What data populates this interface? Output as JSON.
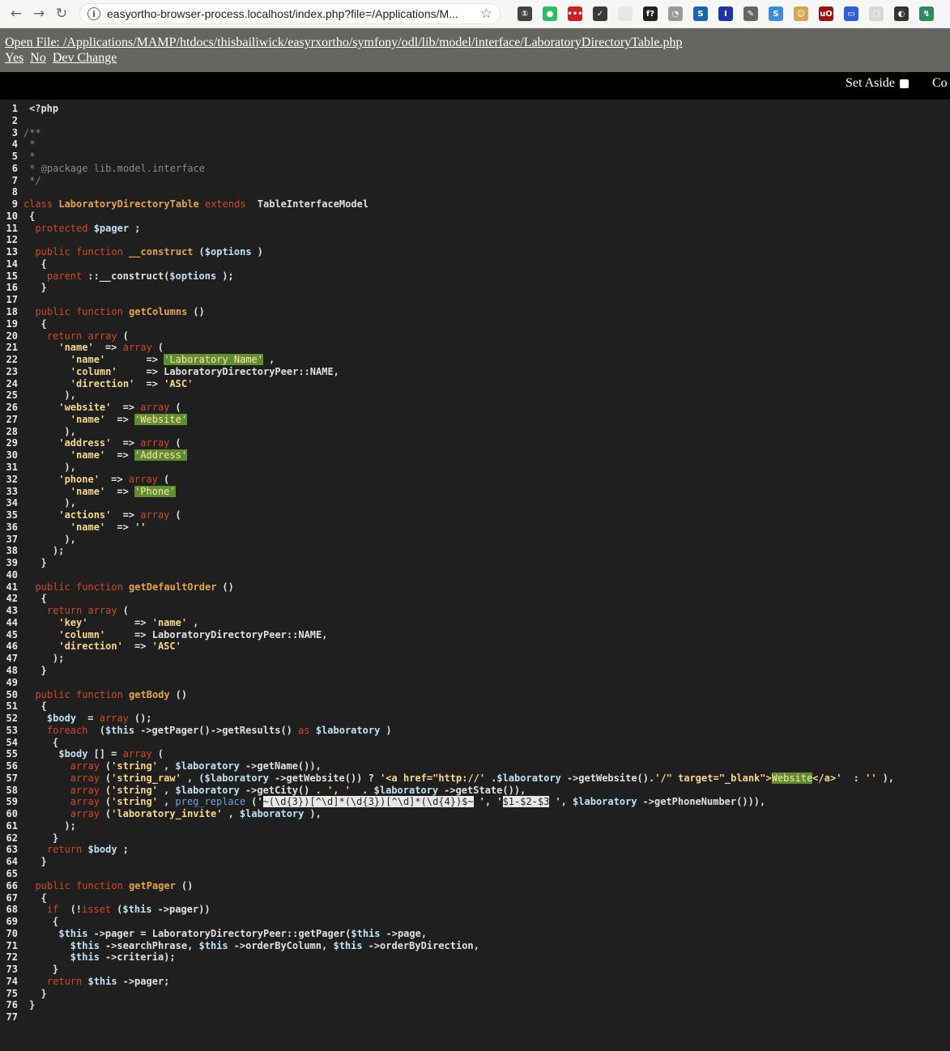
{
  "browser": {
    "url": "easyortho-browser-process.localhost/index.php?file=/Applications/M...",
    "back_glyph": "←",
    "forward_glyph": "→",
    "reload_glyph": "↻",
    "info_glyph": "i",
    "star_glyph": "☆",
    "extensions": [
      {
        "name": "1password-icon",
        "glyph": "①",
        "color": "#444444"
      },
      {
        "name": "evernote-icon",
        "glyph": "●",
        "color": "#2dbe60"
      },
      {
        "name": "lastpass-icon",
        "glyph": "•••",
        "color": "#cc2222"
      },
      {
        "name": "pocket-icon",
        "glyph": "✓",
        "color": "#3a3a3a"
      },
      {
        "name": "blank-extension-icon",
        "glyph": "",
        "color": "#e6e6e6"
      },
      {
        "name": "fx-extension-icon",
        "glyph": "f?",
        "color": "#222222"
      },
      {
        "name": "clock-extension-icon",
        "glyph": "◔",
        "color": "#9a9a9a"
      },
      {
        "name": "session-extension-icon",
        "glyph": "S",
        "color": "#1f63b3"
      },
      {
        "name": "bookmark-extension-icon",
        "glyph": "I",
        "color": "#2233aa"
      },
      {
        "name": "tools-extension-icon",
        "glyph": "✎",
        "color": "#666666"
      },
      {
        "name": "stylus-extension-icon",
        "glyph": "S",
        "color": "#3f8ad6"
      },
      {
        "name": "face-extension-icon",
        "glyph": "☺",
        "color": "#d6a550"
      },
      {
        "name": "ublock-icon",
        "glyph": "uO",
        "color": "#9b1010"
      },
      {
        "name": "calendar-extension-icon",
        "glyph": "▭",
        "color": "#3060d6"
      },
      {
        "name": "copy-extension-icon",
        "glyph": "▢",
        "color": "#d8d8d8"
      },
      {
        "name": "spy-extension-icon",
        "glyph": "◐",
        "color": "#333333"
      },
      {
        "name": "shortcut-extension-icon",
        "glyph": "↯",
        "color": "#2e8b57"
      }
    ]
  },
  "dev": {
    "open_file": "Open File: /Applications/MAMP/htdocs/thisbailiwick/easyrxortho/symfony/odl/lib/model/interface/LaboratoryDirectoryTable.php",
    "yes": "Yes",
    "no": "No",
    "dev_change": "Dev Change",
    "set_aside": "Set Aside",
    "co": "Co"
  },
  "code": [
    {
      "n": "1",
      "t": [
        [
          "src",
          "<?php"
        ]
      ]
    },
    {
      "n": "2",
      "t": []
    },
    {
      "n": "3",
      "t": [
        [
          "cm",
          "/**"
        ]
      ]
    },
    {
      "n": "4",
      "t": [
        [
          "cm",
          " *"
        ]
      ]
    },
    {
      "n": "5",
      "t": [
        [
          "cm",
          " *"
        ]
      ]
    },
    {
      "n": "6",
      "t": [
        [
          "cm",
          " * @package lib.model.interface"
        ]
      ]
    },
    {
      "n": "7",
      "t": [
        [
          "cm",
          " */"
        ]
      ]
    },
    {
      "n": "8",
      "t": []
    },
    {
      "n": "9",
      "t": [
        [
          "kw",
          "class "
        ],
        [
          "cls",
          "LaboratoryDirectoryTable"
        ],
        [
          "kw",
          " extends "
        ],
        [
          "src",
          "TableInterfaceModel"
        ]
      ]
    },
    {
      "n": "10",
      "t": [
        [
          "src",
          "{"
        ]
      ]
    },
    {
      "n": "11",
      "t": [
        [
          "kw",
          "  protected "
        ],
        [
          "var",
          "$pager"
        ],
        [
          "src",
          ";"
        ]
      ]
    },
    {
      "n": "12",
      "t": []
    },
    {
      "n": "13",
      "t": [
        [
          "kw",
          "  public function "
        ],
        [
          "fn",
          "__construct"
        ],
        [
          "src",
          "("
        ],
        [
          "var",
          "$options"
        ],
        [
          "src",
          ")"
        ]
      ]
    },
    {
      "n": "14",
      "t": [
        [
          "src",
          "  {"
        ]
      ]
    },
    {
      "n": "15",
      "t": [
        [
          "kw",
          "    parent"
        ],
        [
          "src",
          "::__construct("
        ],
        [
          "var",
          "$options"
        ],
        [
          "src",
          ");"
        ]
      ]
    },
    {
      "n": "16",
      "t": [
        [
          "src",
          "  }"
        ]
      ]
    },
    {
      "n": "17",
      "t": []
    },
    {
      "n": "18",
      "t": [
        [
          "kw",
          "  public function "
        ],
        [
          "fn",
          "getColumns"
        ],
        [
          "src",
          "()"
        ]
      ]
    },
    {
      "n": "19",
      "t": [
        [
          "src",
          "  {"
        ]
      ]
    },
    {
      "n": "20",
      "t": [
        [
          "kw",
          "    return array"
        ],
        [
          "src",
          "("
        ]
      ]
    },
    {
      "n": "21",
      "t": [
        [
          "str",
          "      'name'"
        ],
        [
          "src",
          " => "
        ],
        [
          "kw",
          "array"
        ],
        [
          "src",
          "("
        ]
      ]
    },
    {
      "n": "22",
      "t": [
        [
          "str",
          "        'name'"
        ],
        [
          "src",
          "      => "
        ],
        [
          "hl",
          "'Laboratory Name'"
        ],
        [
          "src",
          ","
        ]
      ]
    },
    {
      "n": "23",
      "t": [
        [
          "str",
          "        'column'"
        ],
        [
          "src",
          "    => LaboratoryDirectoryPeer::NAME,"
        ]
      ]
    },
    {
      "n": "24",
      "t": [
        [
          "str",
          "        'direction'"
        ],
        [
          "src",
          " => "
        ],
        [
          "str",
          "'ASC'"
        ]
      ]
    },
    {
      "n": "25",
      "t": [
        [
          "src",
          "      ),"
        ]
      ]
    },
    {
      "n": "26",
      "t": [
        [
          "str",
          "      'website'"
        ],
        [
          "src",
          " => "
        ],
        [
          "kw",
          "array"
        ],
        [
          "src",
          "("
        ]
      ]
    },
    {
      "n": "27",
      "t": [
        [
          "str",
          "        'name'"
        ],
        [
          "src",
          " => "
        ],
        [
          "hl",
          "'Website'"
        ]
      ]
    },
    {
      "n": "28",
      "t": [
        [
          "src",
          "      ),"
        ]
      ]
    },
    {
      "n": "29",
      "t": [
        [
          "str",
          "      'address'"
        ],
        [
          "src",
          " => "
        ],
        [
          "kw",
          "array"
        ],
        [
          "src",
          "("
        ]
      ]
    },
    {
      "n": "30",
      "t": [
        [
          "str",
          "        'name'"
        ],
        [
          "src",
          " => "
        ],
        [
          "hl",
          "'Address'"
        ]
      ]
    },
    {
      "n": "31",
      "t": [
        [
          "src",
          "      ),"
        ]
      ]
    },
    {
      "n": "32",
      "t": [
        [
          "str",
          "      'phone'"
        ],
        [
          "src",
          " => "
        ],
        [
          "kw",
          "array"
        ],
        [
          "src",
          "("
        ]
      ]
    },
    {
      "n": "33",
      "t": [
        [
          "str",
          "        'name'"
        ],
        [
          "src",
          " => "
        ],
        [
          "hl",
          "'Phone'"
        ]
      ]
    },
    {
      "n": "34",
      "t": [
        [
          "src",
          "      ),"
        ]
      ]
    },
    {
      "n": "35",
      "t": [
        [
          "str",
          "      'actions'"
        ],
        [
          "src",
          " => "
        ],
        [
          "kw",
          "array"
        ],
        [
          "src",
          "("
        ]
      ]
    },
    {
      "n": "36",
      "t": [
        [
          "str",
          "        'name'"
        ],
        [
          "src",
          " => "
        ],
        [
          "str",
          "''"
        ]
      ]
    },
    {
      "n": "37",
      "t": [
        [
          "src",
          "      ),"
        ]
      ]
    },
    {
      "n": "38",
      "t": [
        [
          "src",
          "    );"
        ]
      ]
    },
    {
      "n": "39",
      "t": [
        [
          "src",
          "  }"
        ]
      ]
    },
    {
      "n": "40",
      "t": []
    },
    {
      "n": "41",
      "t": [
        [
          "kw",
          "  public function "
        ],
        [
          "fn",
          "getDefaultOrder"
        ],
        [
          "src",
          "()"
        ]
      ]
    },
    {
      "n": "42",
      "t": [
        [
          "src",
          "  {"
        ]
      ]
    },
    {
      "n": "43",
      "t": [
        [
          "kw",
          "    return array"
        ],
        [
          "src",
          "("
        ]
      ]
    },
    {
      "n": "44",
      "t": [
        [
          "str",
          "      'key'"
        ],
        [
          "src",
          "       => "
        ],
        [
          "str",
          "'name'"
        ],
        [
          "src",
          ","
        ]
      ]
    },
    {
      "n": "45",
      "t": [
        [
          "str",
          "      'column'"
        ],
        [
          "src",
          "    => LaboratoryDirectoryPeer::NAME,"
        ]
      ]
    },
    {
      "n": "46",
      "t": [
        [
          "str",
          "      'direction'"
        ],
        [
          "src",
          " => "
        ],
        [
          "str",
          "'ASC'"
        ]
      ]
    },
    {
      "n": "47",
      "t": [
        [
          "src",
          "    );"
        ]
      ]
    },
    {
      "n": "48",
      "t": [
        [
          "src",
          "  }"
        ]
      ]
    },
    {
      "n": "49",
      "t": []
    },
    {
      "n": "50",
      "t": [
        [
          "kw",
          "  public function "
        ],
        [
          "fn",
          "getBody"
        ],
        [
          "src",
          "()"
        ]
      ]
    },
    {
      "n": "51",
      "t": [
        [
          "src",
          "  {"
        ]
      ]
    },
    {
      "n": "52",
      "t": [
        [
          "var",
          "    $body"
        ],
        [
          "src",
          " = "
        ],
        [
          "kw",
          "array"
        ],
        [
          "src",
          "();"
        ]
      ]
    },
    {
      "n": "53",
      "t": [
        [
          "kw",
          "    foreach "
        ],
        [
          "src",
          "("
        ],
        [
          "var",
          "$this"
        ],
        [
          "src",
          "->getPager()->getResults() "
        ],
        [
          "kw",
          "as "
        ],
        [
          "var",
          "$laboratory"
        ],
        [
          "src",
          ")"
        ]
      ]
    },
    {
      "n": "54",
      "t": [
        [
          "src",
          "    {"
        ]
      ]
    },
    {
      "n": "55",
      "t": [
        [
          "var",
          "      $body"
        ],
        [
          "src",
          "[] = "
        ],
        [
          "kw",
          "array"
        ],
        [
          "src",
          "("
        ]
      ]
    },
    {
      "n": "56",
      "t": [
        [
          "kw",
          "        array"
        ],
        [
          "src",
          "("
        ],
        [
          "str",
          "'string'"
        ],
        [
          "src",
          ", "
        ],
        [
          "var",
          "$laboratory"
        ],
        [
          "src",
          "->getName()),"
        ]
      ]
    },
    {
      "n": "57",
      "t": [
        [
          "kw",
          "        array"
        ],
        [
          "src",
          "("
        ],
        [
          "str",
          "'string_raw'"
        ],
        [
          "src",
          ", ("
        ],
        [
          "var",
          "$laboratory"
        ],
        [
          "src",
          "->getWebsite()) ? "
        ],
        [
          "str",
          "'<a href=\"http://'"
        ],
        [
          "src",
          "."
        ],
        [
          "var",
          "$laboratory"
        ],
        [
          "src",
          "->getWebsite()."
        ],
        [
          "str",
          "'/\" target=\"_blank\">"
        ],
        [
          "hl",
          "Website"
        ],
        [
          "str",
          "</a>'"
        ],
        [
          "src",
          " : "
        ],
        [
          "str",
          "''"
        ],
        [
          "src",
          "),"
        ]
      ]
    },
    {
      "n": "58",
      "t": [
        [
          "kw",
          "        array"
        ],
        [
          "src",
          "("
        ],
        [
          "str",
          "'string'"
        ],
        [
          "src",
          ", "
        ],
        [
          "var",
          "$laboratory"
        ],
        [
          "src",
          "->getCity() . "
        ],
        [
          "str",
          "', '"
        ],
        [
          "src",
          " . "
        ],
        [
          "var",
          "$laboratory"
        ],
        [
          "src",
          "->getState()),"
        ]
      ]
    },
    {
      "n": "59",
      "t": [
        [
          "kw",
          "        array"
        ],
        [
          "src",
          "("
        ],
        [
          "str",
          "'string'"
        ],
        [
          "src",
          ", "
        ],
        [
          "blue",
          "preg_replace"
        ],
        [
          "src",
          "('"
        ],
        [
          "sel",
          "~(\\d{3})[^\\d]*(\\d{3})[^\\d]*(\\d{4})$~"
        ],
        [
          "src",
          "', '"
        ],
        [
          "sel",
          "$1-$2-$3"
        ],
        [
          "src",
          "', "
        ],
        [
          "var",
          "$laboratory"
        ],
        [
          "src",
          "->getPhoneNumber())),"
        ]
      ]
    },
    {
      "n": "60",
      "t": [
        [
          "kw",
          "        array"
        ],
        [
          "src",
          "("
        ],
        [
          "str",
          "'laboratory_invite'"
        ],
        [
          "src",
          ", "
        ],
        [
          "var",
          "$laboratory"
        ],
        [
          "src",
          "),"
        ]
      ]
    },
    {
      "n": "61",
      "t": [
        [
          "src",
          "      );"
        ]
      ]
    },
    {
      "n": "62",
      "t": [
        [
          "src",
          "    }"
        ]
      ]
    },
    {
      "n": "63",
      "t": [
        [
          "kw",
          "    return "
        ],
        [
          "var",
          "$body"
        ],
        [
          "src",
          ";"
        ]
      ]
    },
    {
      "n": "64",
      "t": [
        [
          "src",
          "  }"
        ]
      ]
    },
    {
      "n": "65",
      "t": []
    },
    {
      "n": "66",
      "t": [
        [
          "kw",
          "  public function "
        ],
        [
          "fn",
          "getPager"
        ],
        [
          "src",
          "()"
        ]
      ]
    },
    {
      "n": "67",
      "t": [
        [
          "src",
          "  {"
        ]
      ]
    },
    {
      "n": "68",
      "t": [
        [
          "kw",
          "    if "
        ],
        [
          "src",
          "(!"
        ],
        [
          "kw",
          "isset"
        ],
        [
          "src",
          "("
        ],
        [
          "var",
          "$this"
        ],
        [
          "src",
          "->pager))"
        ]
      ]
    },
    {
      "n": "69",
      "t": [
        [
          "src",
          "    {"
        ]
      ]
    },
    {
      "n": "70",
      "t": [
        [
          "var",
          "      $this"
        ],
        [
          "src",
          "->pager = LaboratoryDirectoryPeer::getPager("
        ],
        [
          "var",
          "$this"
        ],
        [
          "src",
          "->page,"
        ]
      ]
    },
    {
      "n": "71",
      "t": [
        [
          "var",
          "        $this"
        ],
        [
          "src",
          "->searchPhrase, "
        ],
        [
          "var",
          "$this"
        ],
        [
          "src",
          "->orderByColumn, "
        ],
        [
          "var",
          "$this"
        ],
        [
          "src",
          "->orderByDirection,"
        ]
      ]
    },
    {
      "n": "72",
      "t": [
        [
          "var",
          "        $this"
        ],
        [
          "src",
          "->criteria);"
        ]
      ]
    },
    {
      "n": "73",
      "t": [
        [
          "src",
          "    }"
        ]
      ]
    },
    {
      "n": "74",
      "t": [
        [
          "kw",
          "    return "
        ],
        [
          "var",
          "$this"
        ],
        [
          "src",
          "->pager;"
        ]
      ]
    },
    {
      "n": "75",
      "t": [
        [
          "src",
          "  }"
        ]
      ]
    },
    {
      "n": "76",
      "t": [
        [
          "src",
          "}"
        ]
      ]
    },
    {
      "n": "77",
      "t": []
    }
  ]
}
